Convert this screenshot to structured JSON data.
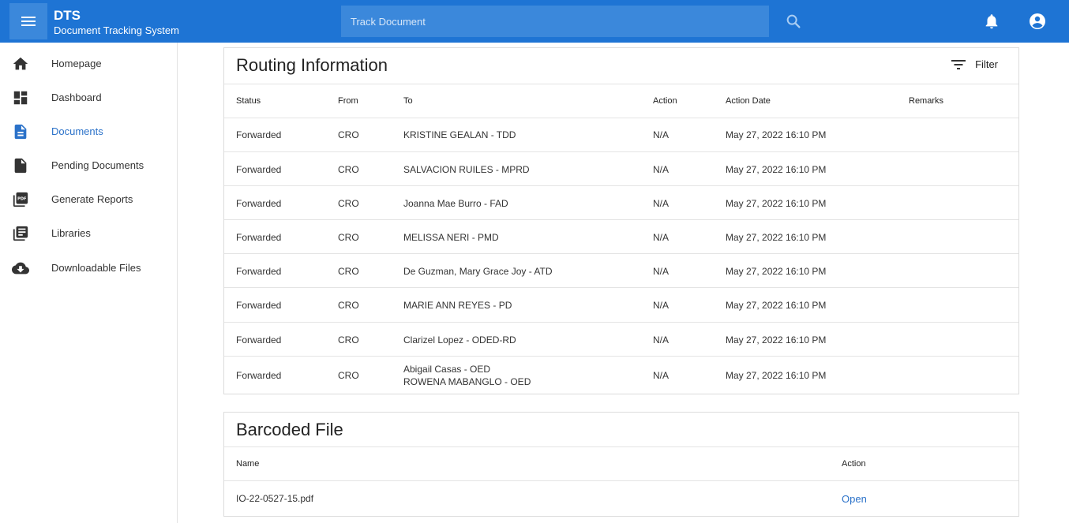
{
  "header": {
    "app_name": "DTS",
    "app_subtitle": "Document Tracking System",
    "search_placeholder": "Track Document"
  },
  "sidebar": {
    "items": [
      {
        "label": "Homepage",
        "icon": "home-icon"
      },
      {
        "label": "Dashboard",
        "icon": "dashboard-icon"
      },
      {
        "label": "Documents",
        "icon": "document-icon",
        "active": true
      },
      {
        "label": "Pending Documents",
        "icon": "file-icon"
      },
      {
        "label": "Generate Reports",
        "icon": "pdf-icon"
      },
      {
        "label": "Libraries",
        "icon": "library-icon"
      },
      {
        "label": "Downloadable Files",
        "icon": "cloud-download-icon"
      }
    ]
  },
  "routing": {
    "title": "Routing Information",
    "filter_label": "Filter",
    "columns": [
      "Status",
      "From",
      "To",
      "Action",
      "Action Date",
      "Remarks"
    ],
    "rows": [
      {
        "status": "Forwarded",
        "from": "CRO",
        "to": [
          "KRISTINE GEALAN - TDD"
        ],
        "action": "N/A",
        "date": "May 27, 2022 16:10 PM",
        "remarks": ""
      },
      {
        "status": "Forwarded",
        "from": "CRO",
        "to": [
          "SALVACION RUILES - MPRD"
        ],
        "action": "N/A",
        "date": "May 27, 2022 16:10 PM",
        "remarks": ""
      },
      {
        "status": "Forwarded",
        "from": "CRO",
        "to": [
          "Joanna Mae Burro - FAD"
        ],
        "action": "N/A",
        "date": "May 27, 2022 16:10 PM",
        "remarks": ""
      },
      {
        "status": "Forwarded",
        "from": "CRO",
        "to": [
          "MELISSA NERI - PMD"
        ],
        "action": "N/A",
        "date": "May 27, 2022 16:10 PM",
        "remarks": ""
      },
      {
        "status": "Forwarded",
        "from": "CRO",
        "to": [
          "De Guzman, Mary Grace Joy - ATD"
        ],
        "action": "N/A",
        "date": "May 27, 2022 16:10 PM",
        "remarks": ""
      },
      {
        "status": "Forwarded",
        "from": "CRO",
        "to": [
          "MARIE ANN REYES - PD"
        ],
        "action": "N/A",
        "date": "May 27, 2022 16:10 PM",
        "remarks": ""
      },
      {
        "status": "Forwarded",
        "from": "CRO",
        "to": [
          "Clarizel Lopez - ODED-RD"
        ],
        "action": "N/A",
        "date": "May 27, 2022 16:10 PM",
        "remarks": ""
      },
      {
        "status": "Forwarded",
        "from": "CRO",
        "to": [
          "Abigail Casas - OED",
          "ROWENA MABANGLO - OED"
        ],
        "action": "N/A",
        "date": "May 27, 2022 16:10 PM",
        "remarks": ""
      }
    ]
  },
  "barcoded": {
    "title": "Barcoded File",
    "columns": [
      "Name",
      "Action"
    ],
    "rows": [
      {
        "name": "IO-22-0527-15.pdf",
        "action": "Open"
      }
    ]
  },
  "colors": {
    "header": "#1e74d4",
    "accent": "#2b72c9"
  }
}
